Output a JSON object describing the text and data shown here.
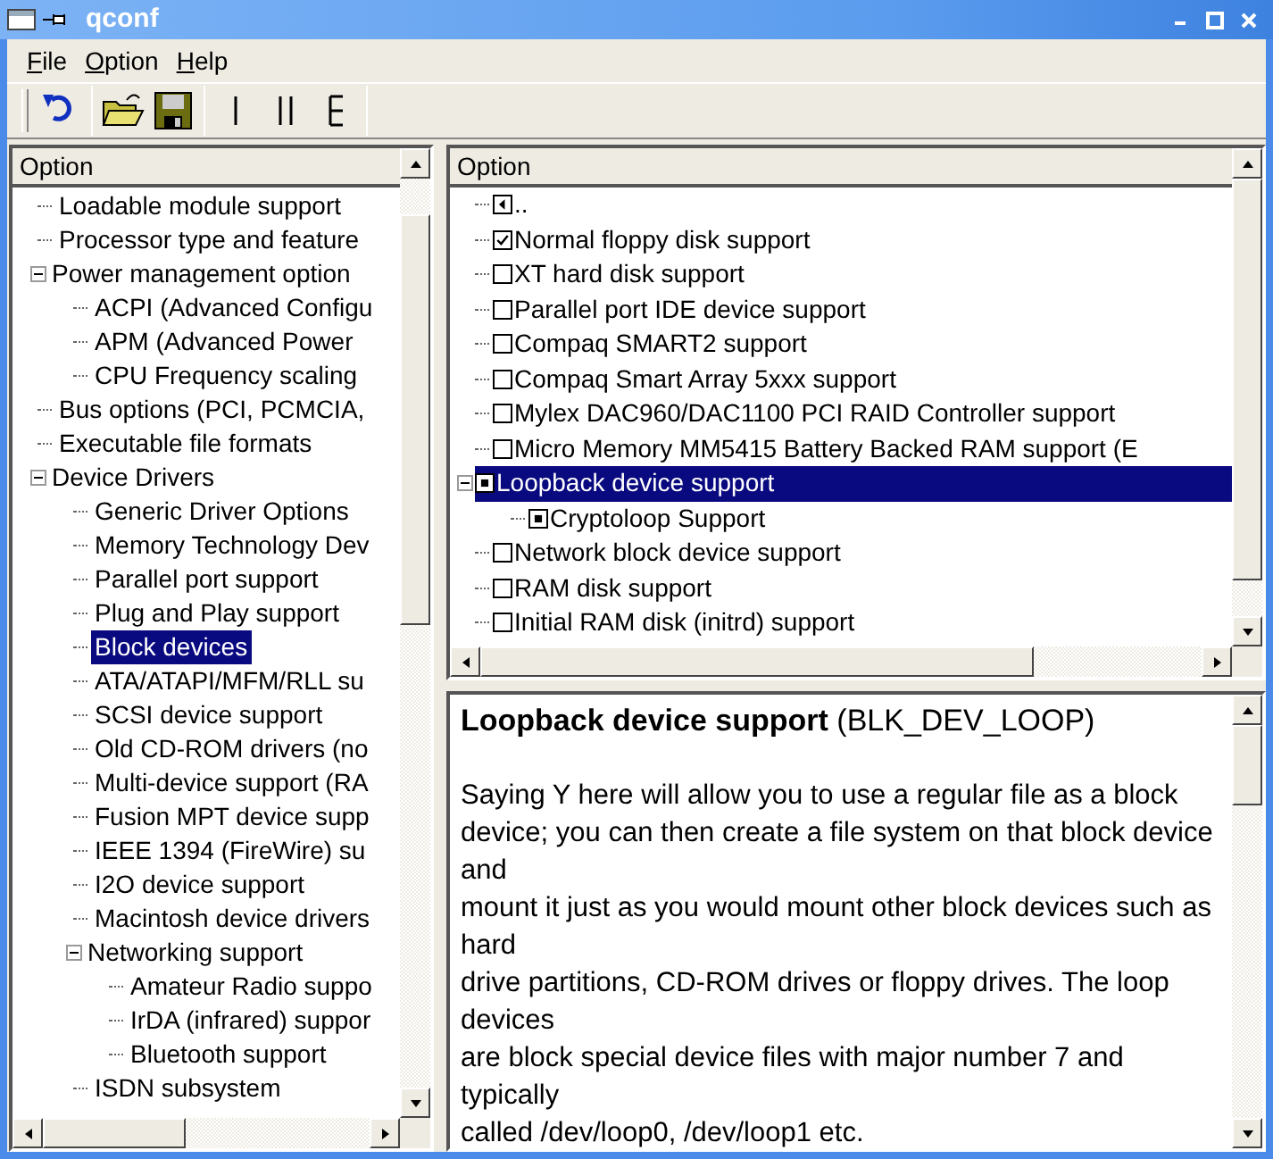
{
  "window": {
    "title": "qconf"
  },
  "menu": [
    {
      "label": "File"
    },
    {
      "label": "Option"
    },
    {
      "label": "Help"
    }
  ],
  "toolbar": [
    {
      "kind": "back"
    },
    {
      "kind": "load"
    },
    {
      "kind": "save"
    },
    {
      "kind": "single"
    },
    {
      "kind": "split"
    },
    {
      "kind": "full"
    }
  ],
  "menu_tree": {
    "header": "Option",
    "items": [
      {
        "label": "Loadable module support",
        "selected": false
      },
      {
        "label": "Processor type and feature",
        "selected": false
      },
      {
        "label": "Power management option",
        "selected": false,
        "expanded": true,
        "children": [
          {
            "label": "ACPI (Advanced Configu",
            "selected": false
          },
          {
            "label": "APM (Advanced Power",
            "selected": false
          },
          {
            "label": "CPU Frequency scaling",
            "selected": false
          }
        ]
      },
      {
        "label": "Bus options (PCI, PCMCIA,",
        "selected": false
      },
      {
        "label": "Executable file formats",
        "selected": false
      },
      {
        "label": "Device Drivers",
        "selected": false,
        "expanded": true,
        "children": [
          {
            "label": "Generic Driver Options",
            "selected": false
          },
          {
            "label": "Memory Technology Dev",
            "selected": false
          },
          {
            "label": "Parallel port support",
            "selected": false
          },
          {
            "label": "Plug and Play support",
            "selected": false
          },
          {
            "label": "Block devices",
            "selected": true
          },
          {
            "label": "ATA/ATAPI/MFM/RLL su",
            "selected": false
          },
          {
            "label": "SCSI device support",
            "selected": false
          },
          {
            "label": "Old CD-ROM drivers (no",
            "selected": false
          },
          {
            "label": "Multi-device support (RA",
            "selected": false
          },
          {
            "label": "Fusion MPT device supp",
            "selected": false
          },
          {
            "label": "IEEE 1394 (FireWire) su",
            "selected": false
          },
          {
            "label": "I2O device support",
            "selected": false
          },
          {
            "label": "Macintosh device drivers",
            "selected": false
          },
          {
            "label": "Networking support",
            "selected": false,
            "expanded": true,
            "children": [
              {
                "label": "Amateur Radio suppo",
                "selected": false
              },
              {
                "label": "IrDA (infrared) suppor",
                "selected": false
              },
              {
                "label": "Bluetooth support",
                "selected": false
              }
            ]
          },
          {
            "label": "ISDN subsystem",
            "selected": false
          }
        ]
      }
    ]
  },
  "option_list": {
    "header": "Option",
    "items": [
      {
        "kind": "back",
        "label": "..",
        "selected": false
      },
      {
        "kind": "bool",
        "label": "Normal floppy disk support",
        "checked": true,
        "selected": false
      },
      {
        "kind": "bool",
        "label": "XT hard disk support",
        "checked": false,
        "selected": false
      },
      {
        "kind": "bool",
        "label": "Parallel port IDE device support",
        "checked": false,
        "selected": false
      },
      {
        "kind": "bool",
        "label": "Compaq SMART2 support",
        "checked": false,
        "selected": false
      },
      {
        "kind": "bool",
        "label": "Compaq Smart Array 5xxx support",
        "checked": false,
        "selected": false
      },
      {
        "kind": "bool",
        "label": "Mylex DAC960/DAC1100 PCI RAID Controller support",
        "checked": false,
        "selected": false
      },
      {
        "kind": "bool",
        "label": "Micro Memory MM5415 Battery Backed RAM support (E",
        "checked": false,
        "selected": false
      },
      {
        "kind": "module",
        "label": "Loopback device support",
        "checked": true,
        "selected": true,
        "expanded": true,
        "children": [
          {
            "kind": "module",
            "label": "Cryptoloop Support",
            "checked": true,
            "selected": false
          }
        ]
      },
      {
        "kind": "bool",
        "label": "Network block device support",
        "checked": false,
        "selected": false
      },
      {
        "kind": "bool",
        "label": "RAM disk support",
        "checked": false,
        "selected": false
      },
      {
        "kind": "bool",
        "label": "Initial RAM disk (initrd) support",
        "checked": false,
        "selected": false
      }
    ]
  },
  "help": {
    "heading": "**Loopback device support** (BLK_DEV_LOOP)",
    "lines": [
      "Saying Y here will allow you to use a regular file as a block device; you can then create a file system on that block device and",
      "mount it just as you would mount other block devices such as hard",
      "drive partitions, CD-ROM drives or floppy drives. The loop devices",
      "are block special device files with major number 7 and typically",
      "called /dev/loop0, /dev/loop1 etc."
    ]
  }
}
